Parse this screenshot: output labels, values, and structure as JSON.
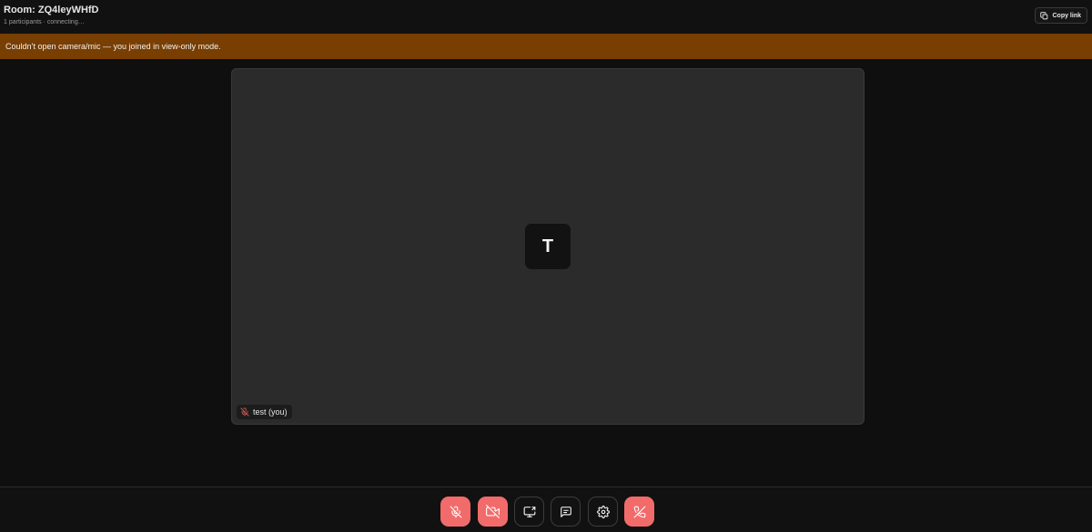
{
  "header": {
    "room_title": "Room: ZQ4leyWHfD",
    "status": "1 participants · connecting…",
    "copy_link_label": "Copy link"
  },
  "banner": {
    "text": "Couldn’t open camera/mic — you joined in view-only mode.",
    "color": "#783e02"
  },
  "tile": {
    "avatar_initial": "T",
    "name_label": "test (you)",
    "muted_icon": "mic-off-icon"
  },
  "controls": {
    "accent_danger": "#f26b6b",
    "buttons": [
      {
        "name": "mic-toggle",
        "icon": "mic-off-icon",
        "state": "off"
      },
      {
        "name": "camera-toggle",
        "icon": "video-off-icon",
        "state": "off"
      },
      {
        "name": "screen-share",
        "icon": "screen-share-icon"
      },
      {
        "name": "chat",
        "icon": "chat-icon"
      },
      {
        "name": "settings",
        "icon": "gear-icon"
      },
      {
        "name": "leave-call",
        "icon": "phone-off-icon"
      }
    ]
  }
}
